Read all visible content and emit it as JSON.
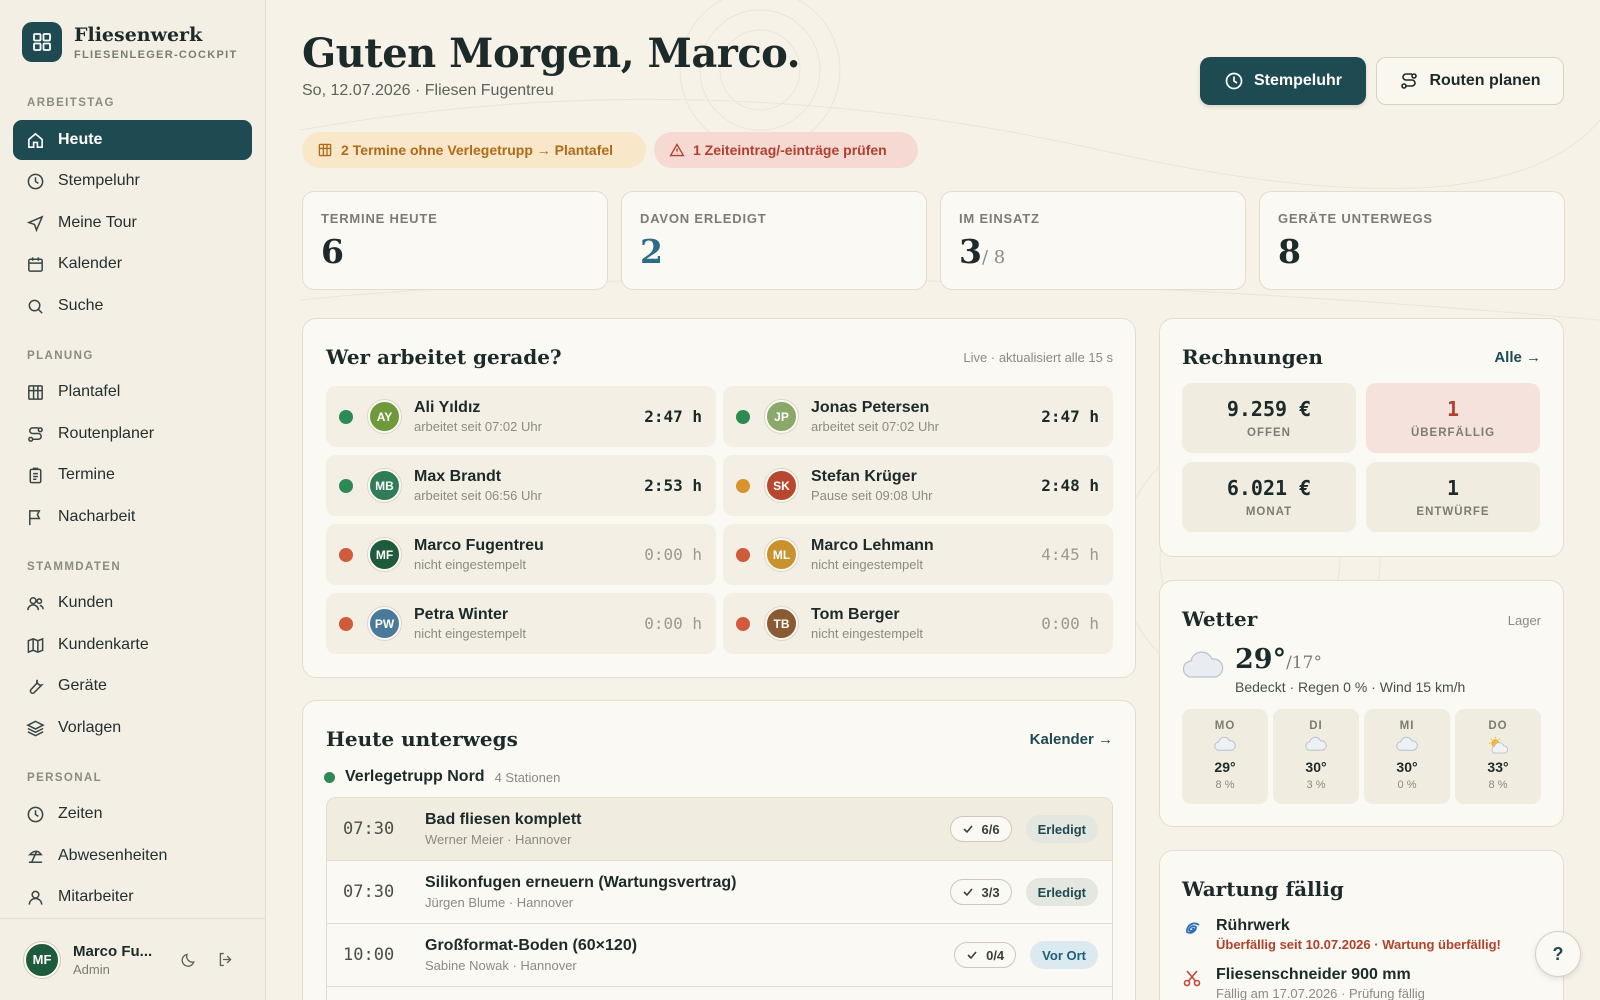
{
  "brand": {
    "name": "Fliesenwerk",
    "subtitle": "FLIESENLEGER-COCKPIT"
  },
  "nav": {
    "sections": [
      {
        "label": "ARBEITSTAG",
        "items": [
          {
            "label": "Heute",
            "icon": "home-icon",
            "active": true
          },
          {
            "label": "Stempeluhr",
            "icon": "clock-icon"
          },
          {
            "label": "Meine Tour",
            "icon": "send-icon"
          },
          {
            "label": "Kalender",
            "icon": "calendar-icon"
          },
          {
            "label": "Suche",
            "icon": "search-icon"
          }
        ]
      },
      {
        "label": "PLANUNG",
        "items": [
          {
            "label": "Plantafel",
            "icon": "grid-icon"
          },
          {
            "label": "Routenplaner",
            "icon": "route-icon"
          },
          {
            "label": "Termine",
            "icon": "clipboard-icon"
          },
          {
            "label": "Nacharbeit",
            "icon": "flag-icon"
          }
        ]
      },
      {
        "label": "STAMMDATEN",
        "items": [
          {
            "label": "Kunden",
            "icon": "users-icon"
          },
          {
            "label": "Kundenkarte",
            "icon": "map-icon"
          },
          {
            "label": "Geräte",
            "icon": "wrench-icon"
          },
          {
            "label": "Vorlagen",
            "icon": "layers-icon"
          }
        ]
      },
      {
        "label": "PERSONAL",
        "items": [
          {
            "label": "Zeiten",
            "icon": "clock-icon"
          },
          {
            "label": "Abwesenheiten",
            "icon": "beach-icon"
          },
          {
            "label": "Mitarbeiter",
            "icon": "user-icon"
          }
        ]
      }
    ]
  },
  "user": {
    "initials": "MF",
    "name": "Marco Fu...",
    "role": "Admin"
  },
  "header": {
    "greeting": "Guten Morgen, Marco.",
    "date": "So, 12.07.2026 · Fliesen Fugentreu",
    "btn_clock": "Stempeluhr",
    "btn_routes": "Routen planen"
  },
  "alerts": {
    "warn": "2 Termine ohne Verlegetrupp → Plantafel",
    "alert": "1 Zeiteintrag/-einträge prüfen"
  },
  "stats": [
    {
      "label": "TERMINE HEUTE",
      "value": "6",
      "suffix": ""
    },
    {
      "label": "DAVON ERLEDIGT",
      "value": "2",
      "suffix": ""
    },
    {
      "label": "IM EINSATZ",
      "value": "3",
      "suffix": "/ 8"
    },
    {
      "label": "GERÄTE UNTERWEGS",
      "value": "8",
      "suffix": ""
    }
  ],
  "workers_card": {
    "title": "Wer arbeitet gerade?",
    "meta": "Live · aktualisiert alle 15 s",
    "workers": [
      {
        "initials": "AY",
        "name": "Ali Yıldız",
        "sub": "arbeitet seit 07:02 Uhr",
        "time": "2:47 h",
        "status": "#2e8a55",
        "color": "#6f9a3c",
        "active": true
      },
      {
        "initials": "JP",
        "name": "Jonas Petersen",
        "sub": "arbeitet seit 07:02 Uhr",
        "time": "2:47 h",
        "status": "#2e8a55",
        "color": "#8aa86a",
        "active": true
      },
      {
        "initials": "MB",
        "name": "Max Brandt",
        "sub": "arbeitet seit 06:56 Uhr",
        "time": "2:53 h",
        "status": "#2e8a55",
        "color": "#2e7d57",
        "active": true
      },
      {
        "initials": "SK",
        "name": "Stefan Krüger",
        "sub": "Pause seit 09:08 Uhr",
        "time": "2:48 h",
        "status": "#d9922e",
        "color": "#b7472e",
        "active": true
      },
      {
        "initials": "MF",
        "name": "Marco Fugentreu",
        "sub": "nicht eingestempelt",
        "time": "0:00 h",
        "status": "#d05a3c",
        "color": "#1e5a3c",
        "active": false
      },
      {
        "initials": "ML",
        "name": "Marco Lehmann",
        "sub": "nicht eingestempelt",
        "time": "4:45 h",
        "status": "#d05a3c",
        "color": "#c9922e",
        "active": false
      },
      {
        "initials": "PW",
        "name": "Petra Winter",
        "sub": "nicht eingestempelt",
        "time": "0:00 h",
        "status": "#d05a3c",
        "color": "#4a7a9a",
        "active": false
      },
      {
        "initials": "TB",
        "name": "Tom Berger",
        "sub": "nicht eingestempelt",
        "time": "0:00 h",
        "status": "#d05a3c",
        "color": "#8a5a32",
        "active": false
      }
    ]
  },
  "tour_card": {
    "title": "Heute unterwegs",
    "link": "Kalender →",
    "team": "Verlegetrupp Nord",
    "count": "4 Stationen",
    "stops": [
      {
        "time": "07:30",
        "title": "Bad fliesen komplett",
        "sub": "Werner Meier · Hannover",
        "progress": "6/6",
        "status": "Erledigt",
        "kind": "done"
      },
      {
        "time": "07:30",
        "title": "Silikonfugen erneuern (Wartungsvertrag)",
        "sub": "Jürgen Blume · Hannover",
        "progress": "3/3",
        "status": "Erledigt",
        "kind": "done"
      },
      {
        "time": "10:00",
        "title": "Großformat-Boden (60×120)",
        "sub": "Sabine Nowak · Hannover",
        "progress": "0/4",
        "status": "Vor Ort",
        "kind": "onsite"
      }
    ]
  },
  "invoices": {
    "title": "Rechnungen",
    "link": "Alle →",
    "tiles": [
      {
        "value": "9.259 €",
        "label": "OFFEN"
      },
      {
        "value": "1",
        "label": "ÜBERFÄLLIG"
      },
      {
        "value": "6.021 €",
        "label": "MONAT"
      },
      {
        "value": "1",
        "label": "ENTWÜRFE"
      }
    ]
  },
  "weather": {
    "title": "Wetter",
    "location": "Lager",
    "temp": "29°",
    "low": "/17°",
    "desc": "Bedeckt · Regen 0 % · Wind 15 km/h",
    "days": [
      {
        "day": "MO",
        "temp": "29°",
        "rain": "8 %",
        "icon": "cloud-icon"
      },
      {
        "day": "DI",
        "temp": "30°",
        "rain": "3 %",
        "icon": "cloud-icon"
      },
      {
        "day": "MI",
        "temp": "30°",
        "rain": "0 %",
        "icon": "cloud-icon"
      },
      {
        "day": "DO",
        "temp": "33°",
        "rain": "8 %",
        "icon": "sun-cloud-icon"
      }
    ]
  },
  "maintenance": {
    "title": "Wartung fällig",
    "items": [
      {
        "title": "Rührwerk",
        "sub": "Überfällig seit 10.07.2026 · Wartung überfällig!",
        "icon": "spiral-icon"
      },
      {
        "title": "Fliesenschneider 900 mm",
        "sub": "Fällig am 17.07.2026 · Prüfung fällig",
        "icon": "scissors-icon"
      }
    ]
  },
  "help": "?",
  "colors": {
    "primary": "#1e4a52",
    "background": "#f6f2e8",
    "card": "#fbf9f3",
    "danger": "#b0412c",
    "warning": "#b06a1a",
    "success": "#2e8a55"
  }
}
